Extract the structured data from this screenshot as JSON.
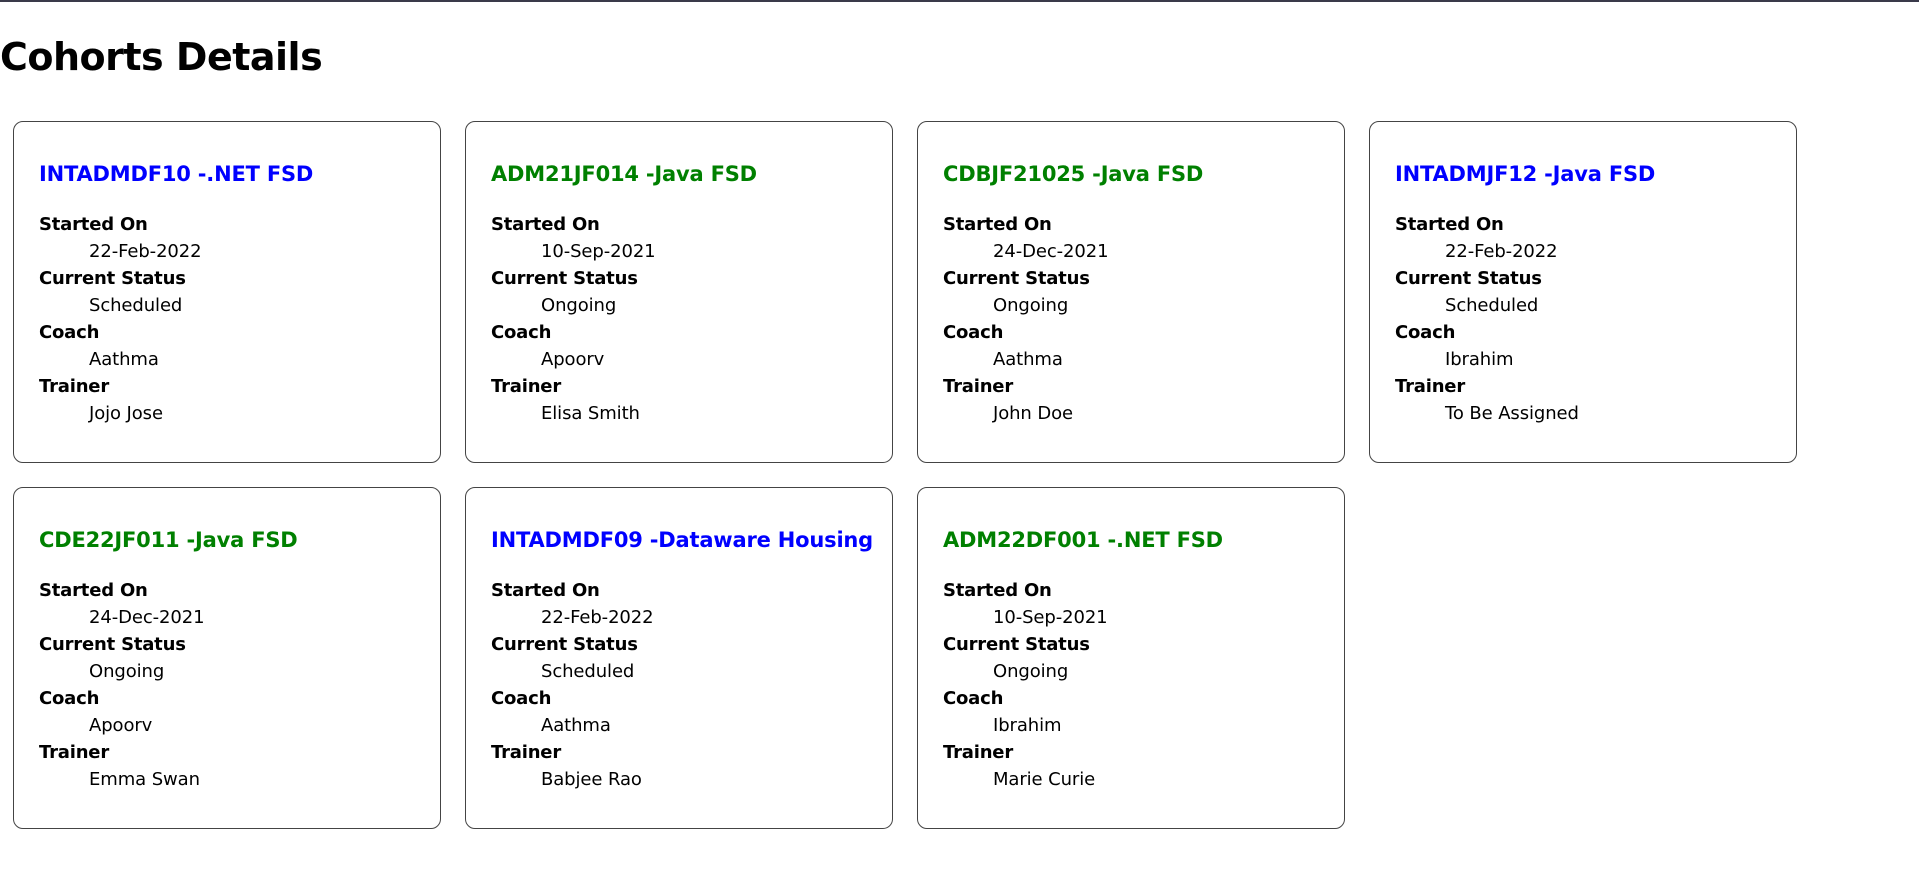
{
  "page": {
    "title": "Cohorts Details"
  },
  "labels": {
    "started_on": "Started On",
    "current_status": "Current Status",
    "coach": "Coach",
    "trainer": "Trainer"
  },
  "colors": {
    "ongoing": "#008000",
    "scheduled": "#0000ff"
  },
  "cohorts": [
    {
      "title": "INTADMDF10 -.NET FSD",
      "started_on": "22-Feb-2022",
      "status": "Scheduled",
      "coach": "Aathma",
      "trainer": "Jojo Jose"
    },
    {
      "title": "ADM21JF014 -Java FSD",
      "started_on": "10-Sep-2021",
      "status": "Ongoing",
      "coach": "Apoorv",
      "trainer": "Elisa Smith"
    },
    {
      "title": "CDBJF21025 -Java FSD",
      "started_on": "24-Dec-2021",
      "status": "Ongoing",
      "coach": "Aathma",
      "trainer": "John Doe"
    },
    {
      "title": "INTADMJF12 -Java FSD",
      "started_on": "22-Feb-2022",
      "status": "Scheduled",
      "coach": "Ibrahim",
      "trainer": "To Be Assigned"
    },
    {
      "title": "CDE22JF011 -Java FSD",
      "started_on": "24-Dec-2021",
      "status": "Ongoing",
      "coach": "Apoorv",
      "trainer": "Emma Swan"
    },
    {
      "title": "INTADMDF09 -Dataware Housing",
      "started_on": "22-Feb-2022",
      "status": "Scheduled",
      "coach": "Aathma",
      "trainer": "Babjee Rao"
    },
    {
      "title": "ADM22DF001 -.NET FSD",
      "started_on": "10-Sep-2021",
      "status": "Ongoing",
      "coach": "Ibrahim",
      "trainer": "Marie Curie"
    }
  ]
}
